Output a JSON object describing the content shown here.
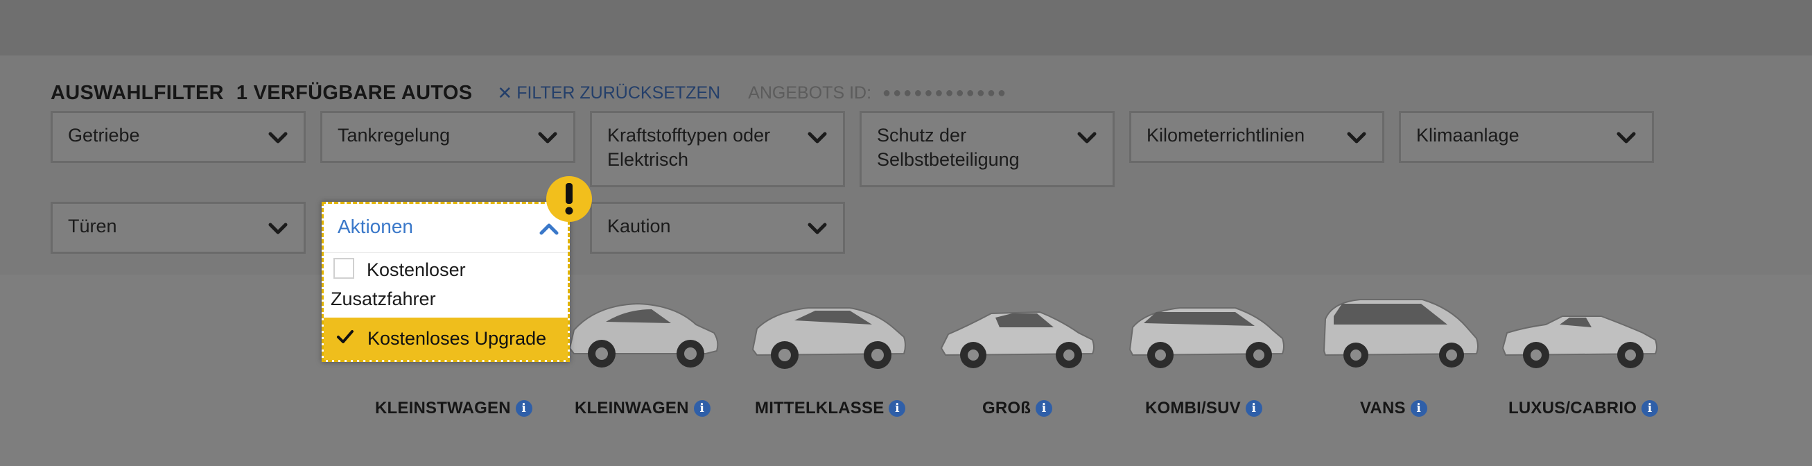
{
  "filters": {
    "heading": "AUSWAHLFILTER",
    "available_count": "1 VERFÜGBARE AUTOS",
    "reset_label": "FILTER ZURÜCKSETZEN",
    "offer_id_label": "ANGEBOTS ID:",
    "offer_id_value": "●●●●●●●●●●●●",
    "dropdowns": [
      "Getriebe",
      "Tankregelung",
      "Kraftstofftypen oder Elektrisch",
      "Schutz der Selbstbeteiligung",
      "Kilometerrichtlinien",
      "Klimaanlage",
      "Türen",
      "Aktionen",
      "Kaution"
    ],
    "aktionen_options": [
      {
        "label": "Kostenloser Zusatzfahrer",
        "checked": false
      },
      {
        "label": "Kostenloses Upgrade",
        "checked": true
      }
    ]
  },
  "categories": [
    "KLEINSTWAGEN",
    "KLEINWAGEN",
    "MITTELKLASSE",
    "GROß",
    "KOMBI/SUV",
    "VANS",
    "LUXUS/CABRIO"
  ],
  "colors": {
    "overlay_gray": "#7e7e7e",
    "accent_yellow": "#efbe1c",
    "link_blue": "#3a78c9",
    "info_blue": "#2f5fa8"
  },
  "icons": {
    "reset": "close-icon",
    "dropdown": "chevron-down-icon",
    "open_dropdown": "chevron-up-icon",
    "warning": "exclamation-icon",
    "info": "info-icon",
    "checked": "checkmark-icon"
  }
}
